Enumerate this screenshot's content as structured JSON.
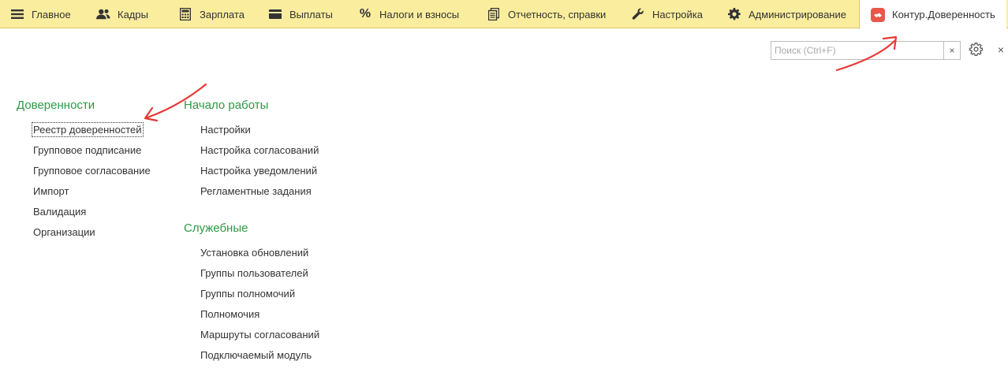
{
  "sections": {
    "tabs": [
      {
        "label": "Главное",
        "icon": "menu-icon"
      },
      {
        "label": "Кадры",
        "icon": "people-icon"
      },
      {
        "label": "Зарплата",
        "icon": "calculator-icon"
      },
      {
        "label": "Выплаты",
        "icon": "card-icon"
      },
      {
        "label": "Налоги и взносы",
        "icon": "percent-icon"
      },
      {
        "label": "Отчетность, справки",
        "icon": "documents-icon"
      },
      {
        "label": "Настройка",
        "icon": "wrench-icon"
      },
      {
        "label": "Администрирование",
        "icon": "gear-icon"
      },
      {
        "label": "Контур.Доверенность",
        "icon": "kontur-logo-icon",
        "active": true
      }
    ]
  },
  "search": {
    "placeholder": "Поиск (Ctrl+F)",
    "value": "",
    "clear_label": "×"
  },
  "toolbar": {
    "close_label": "×"
  },
  "groups": [
    {
      "title": "Доверенности",
      "items": [
        "Реестр доверенностей",
        "Групповое подписание",
        "Групповое согласование",
        "Импорт",
        "Валидация",
        "Организации"
      ]
    },
    {
      "title": "Начало работы",
      "items": [
        "Настройки",
        "Настройка согласований",
        "Настройка уведомлений",
        "Регламентные задания"
      ]
    },
    {
      "title": "Служебные",
      "items": [
        "Установка обновлений",
        "Группы пользователей",
        "Группы полномочий",
        "Полномочия",
        "Маршруты согласований",
        "Подключаемый модуль"
      ]
    }
  ],
  "colors": {
    "section_bar": "#fbed9e",
    "group_title": "#2c9a47",
    "annotation_arrow": "#e53935"
  }
}
